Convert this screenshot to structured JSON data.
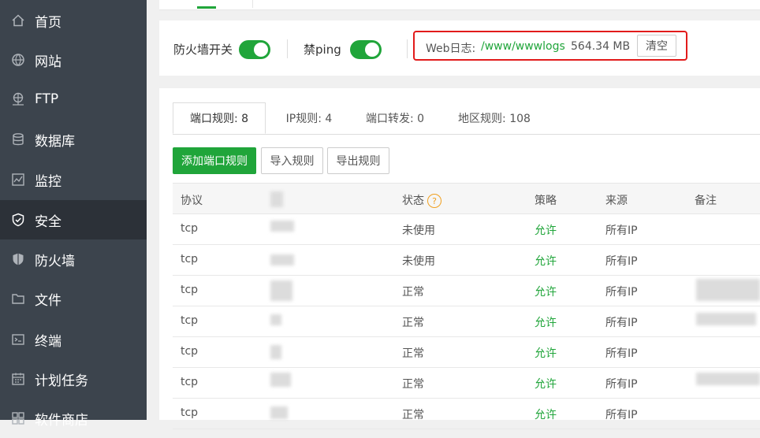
{
  "sidebar": {
    "items": [
      {
        "label": "首页",
        "icon": "home-icon"
      },
      {
        "label": "网站",
        "icon": "globe-icon"
      },
      {
        "label": "FTP",
        "icon": "ftp-icon"
      },
      {
        "label": "数据库",
        "icon": "database-icon"
      },
      {
        "label": "监控",
        "icon": "monitor-icon"
      },
      {
        "label": "安全",
        "icon": "shield-icon"
      },
      {
        "label": "防火墙",
        "icon": "firewall-icon"
      },
      {
        "label": "文件",
        "icon": "folder-icon"
      },
      {
        "label": "终端",
        "icon": "terminal-icon"
      },
      {
        "label": "计划任务",
        "icon": "calendar-icon"
      },
      {
        "label": "软件商店",
        "icon": "store-icon"
      }
    ]
  },
  "toggles": {
    "firewall_label": "防火墙开关",
    "firewall_on": true,
    "ping_label": "禁ping",
    "ping_on": true
  },
  "weblog": {
    "label": "Web日志:",
    "path": "/www/wwwlogs",
    "size": "564.34 MB",
    "clear_label": "清空"
  },
  "tabs": [
    {
      "label": "端口规则: 8",
      "active": true
    },
    {
      "label": "IP规则: 4",
      "active": false
    },
    {
      "label": "端口转发: 0",
      "active": false
    },
    {
      "label": "地区规则: 108",
      "active": false
    }
  ],
  "actions": {
    "add_label": "添加端口规则",
    "import_label": "导入规则",
    "export_label": "导出规则"
  },
  "table": {
    "headers": {
      "protocol": "协议",
      "status": "状态",
      "policy": "策略",
      "source": "来源",
      "remark": "备注"
    },
    "help_symbol": "?",
    "rows": [
      {
        "protocol": "tcp",
        "status": "未使用",
        "policy": "允许",
        "source": "所有IP"
      },
      {
        "protocol": "tcp",
        "status": "未使用",
        "policy": "允许",
        "source": "所有IP"
      },
      {
        "protocol": "tcp",
        "status": "正常",
        "policy": "允许",
        "source": "所有IP"
      },
      {
        "protocol": "tcp",
        "status": "正常",
        "policy": "允许",
        "source": "所有IP"
      },
      {
        "protocol": "tcp",
        "status": "正常",
        "policy": "允许",
        "source": "所有IP"
      },
      {
        "protocol": "tcp",
        "status": "正常",
        "policy": "允许",
        "source": "所有IP"
      },
      {
        "protocol": "tcp",
        "status": "正常",
        "policy": "允许",
        "source": "所有IP"
      }
    ]
  },
  "colors": {
    "sidebar_bg": "#3c444d",
    "sidebar_active": "#2c3138",
    "accent_green": "#20a53a",
    "highlight_red": "#e21b1b"
  }
}
